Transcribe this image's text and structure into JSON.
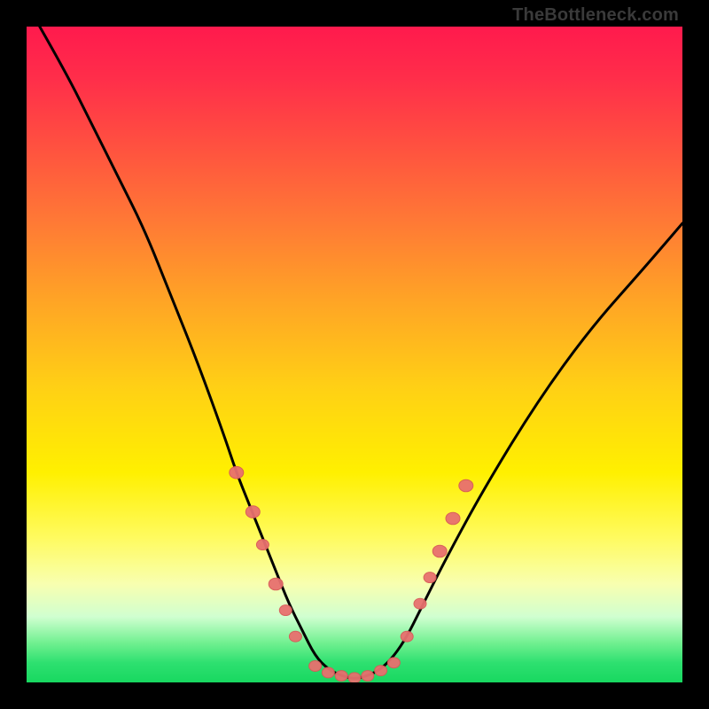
{
  "watermark": "TheBottleneck.com",
  "chart_data": {
    "type": "line",
    "title": "",
    "xlabel": "",
    "ylabel": "",
    "xlim": [
      0,
      100
    ],
    "ylim": [
      0,
      100
    ],
    "series": [
      {
        "name": "curve",
        "x": [
          2,
          6,
          10,
          14,
          18,
          22,
          26,
          30,
          32,
          34,
          36,
          38,
          40,
          42,
          44,
          46,
          48,
          50,
          52,
          54,
          56,
          58,
          60,
          64,
          70,
          78,
          86,
          94,
          100
        ],
        "y": [
          100,
          93,
          85,
          77,
          69,
          59,
          49,
          38,
          32,
          27,
          22,
          17,
          12,
          8,
          4,
          2,
          1,
          0.5,
          1,
          2,
          4,
          7,
          11,
          19,
          30,
          43,
          54,
          63,
          70
        ]
      }
    ],
    "annotations": {
      "beads_left": [
        {
          "x": 32,
          "y": 32,
          "r": 8
        },
        {
          "x": 34.5,
          "y": 26,
          "r": 8
        },
        {
          "x": 36,
          "y": 21,
          "r": 7
        },
        {
          "x": 38,
          "y": 15,
          "r": 8
        },
        {
          "x": 39.5,
          "y": 11,
          "r": 7
        },
        {
          "x": 41,
          "y": 7,
          "r": 7
        }
      ],
      "beads_bottom": [
        {
          "x": 44,
          "y": 2.5,
          "r": 7
        },
        {
          "x": 46,
          "y": 1.5,
          "r": 7
        },
        {
          "x": 48,
          "y": 1,
          "r": 7
        },
        {
          "x": 50,
          "y": 0.7,
          "r": 7
        },
        {
          "x": 52,
          "y": 1,
          "r": 7
        },
        {
          "x": 54,
          "y": 1.8,
          "r": 7
        },
        {
          "x": 56,
          "y": 3,
          "r": 7
        }
      ],
      "beads_right": [
        {
          "x": 58,
          "y": 7,
          "r": 7
        },
        {
          "x": 60,
          "y": 12,
          "r": 7
        },
        {
          "x": 61.5,
          "y": 16,
          "r": 7
        },
        {
          "x": 63,
          "y": 20,
          "r": 8
        },
        {
          "x": 65,
          "y": 25,
          "r": 8
        },
        {
          "x": 67,
          "y": 30,
          "r": 8
        }
      ]
    },
    "background_gradient": {
      "top_color": "#ff1a4d",
      "mid_color": "#fff000",
      "bottom_color": "#18d860"
    }
  }
}
